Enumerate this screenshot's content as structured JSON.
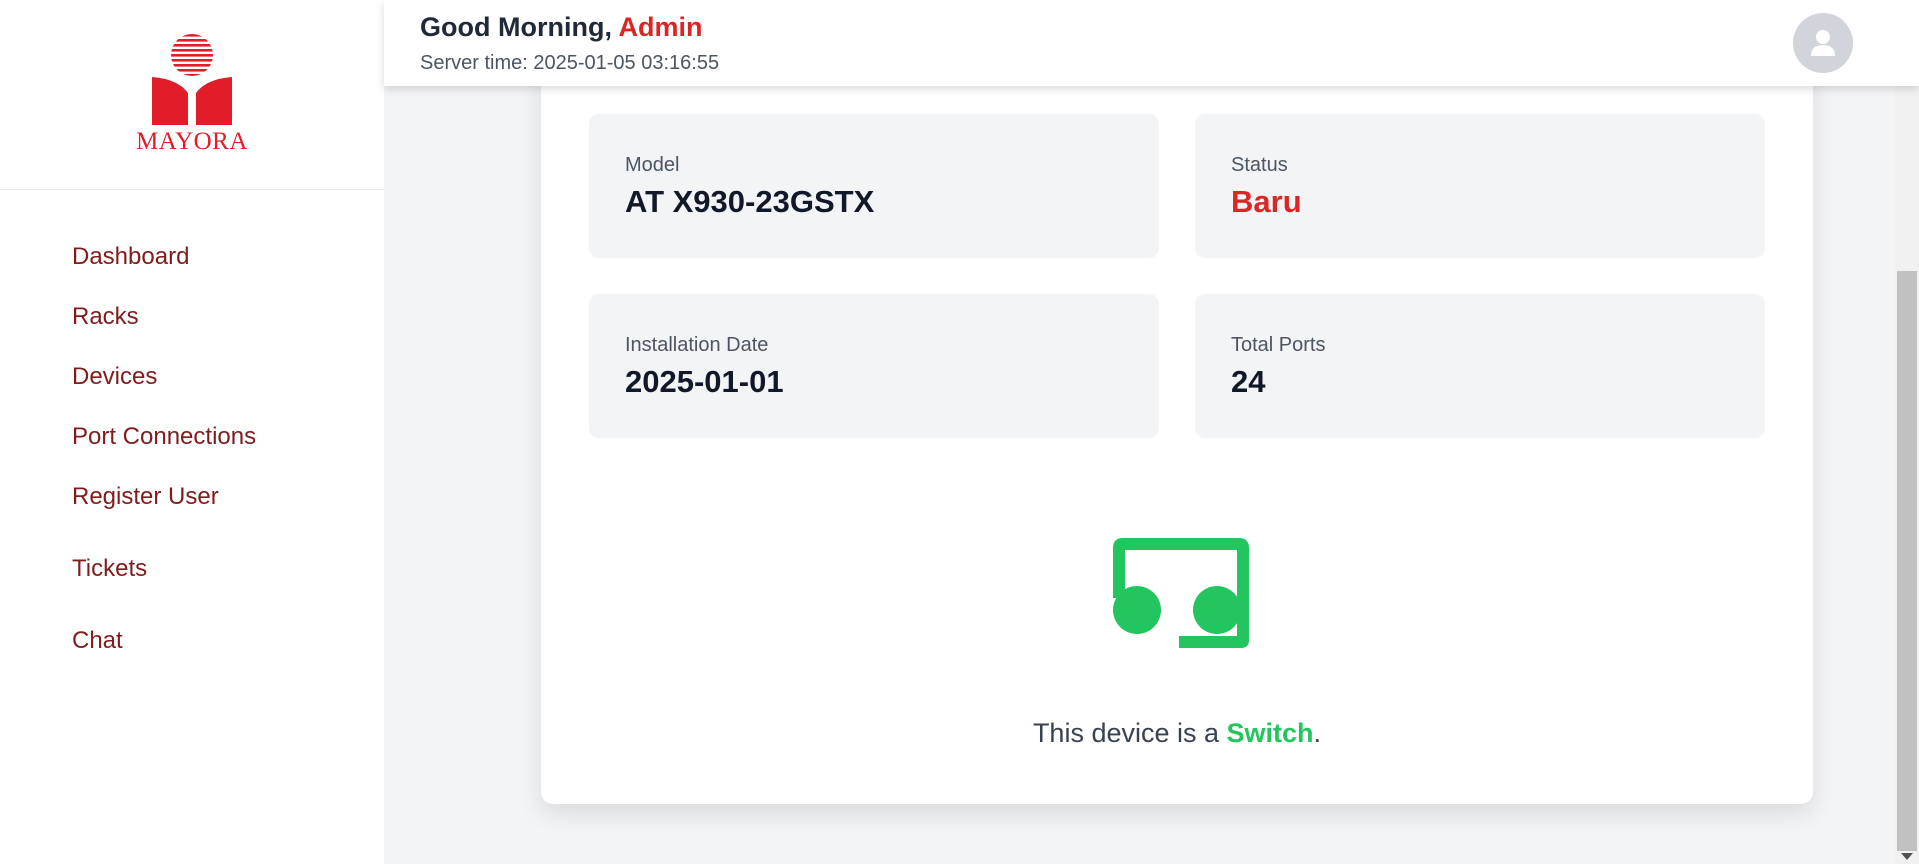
{
  "brand": {
    "name": "MAYORA",
    "color": "#e11d2a"
  },
  "sidebar": {
    "items": [
      {
        "label": "Dashboard"
      },
      {
        "label": "Racks"
      },
      {
        "label": "Devices"
      },
      {
        "label": "Port Connections"
      },
      {
        "label": "Register User"
      },
      {
        "label": "Tickets"
      },
      {
        "label": "Chat"
      }
    ]
  },
  "header": {
    "greeting": "Good Morning,",
    "username": "Admin",
    "server_time": "Server time: 2025-01-05 03:16:55",
    "avatar_icon": "user-icon"
  },
  "device": {
    "model_label": "Model",
    "model_value": "AT X930-23GSTX",
    "status_label": "Status",
    "status_value": "Baru",
    "install_label": "Installation Date",
    "install_value": "2025-01-01",
    "ports_label": "Total Ports",
    "ports_value": "24",
    "icon": "switch-icon",
    "type_prefix": "This device is a",
    "type_value": "Switch",
    "type_suffix": "."
  },
  "colors": {
    "accent_red": "#dc2626",
    "nav_text": "#7f1d1d",
    "switch_green": "#22c55e"
  }
}
